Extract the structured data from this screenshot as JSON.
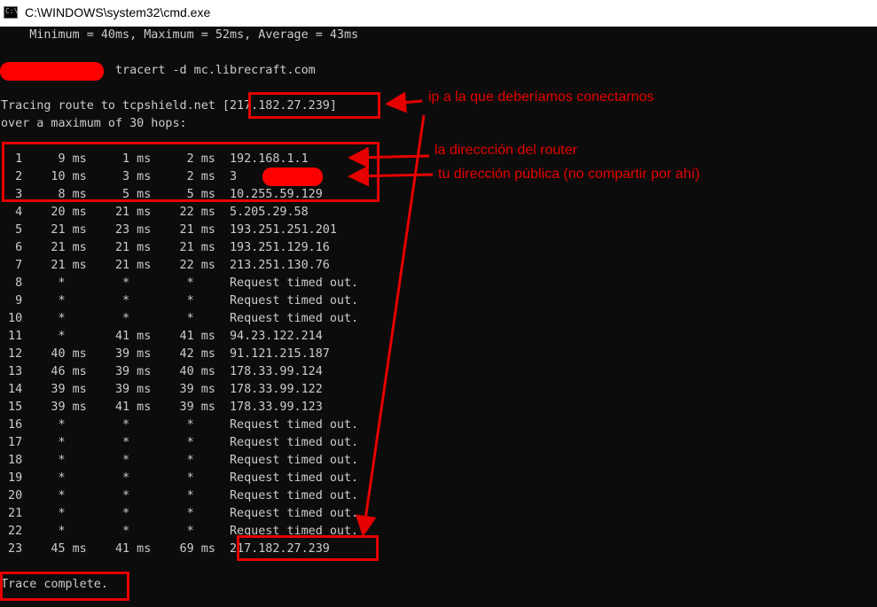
{
  "window": {
    "title": "C:\\WINDOWS\\system32\\cmd.exe",
    "icon": "cmd-console-icon",
    "icon_text": "C:\\"
  },
  "console": {
    "lines": [
      "    Minimum = 40ms, Maximum = 52ms, Average = 43ms",
      "",
      "                tracert -d mc.librecraft.com",
      "",
      "Tracing route to tcpshield.net [217.182.27.239]",
      "over a maximum of 30 hops:",
      "",
      "  1     9 ms     1 ms     2 ms  192.168.1.1",
      "  2    10 ms     3 ms     2 ms  3        .1",
      "  3     8 ms     5 ms     5 ms  10.255.59.129",
      "  4    20 ms    21 ms    22 ms  5.205.29.58",
      "  5    21 ms    23 ms    21 ms  193.251.251.201",
      "  6    21 ms    21 ms    21 ms  193.251.129.16",
      "  7    21 ms    21 ms    22 ms  213.251.130.76",
      "  8     *        *        *     Request timed out.",
      "  9     *        *        *     Request timed out.",
      " 10     *        *        *     Request timed out.",
      " 11     *       41 ms    41 ms  94.23.122.214",
      " 12    40 ms    39 ms    42 ms  91.121.215.187",
      " 13    46 ms    39 ms    40 ms  178.33.99.124",
      " 14    39 ms    39 ms    39 ms  178.33.99.122",
      " 15    39 ms    41 ms    39 ms  178.33.99.123",
      " 16     *        *        *     Request timed out.",
      " 17     *        *        *     Request timed out.",
      " 18     *        *        *     Request timed out.",
      " 19     *        *        *     Request timed out.",
      " 20     *        *        *     Request timed out.",
      " 21     *        *        *     Request timed out.",
      " 22     *        *        *     Request timed out.",
      " 23    45 ms    41 ms    69 ms  217.182.27.239",
      "",
      "Trace complete."
    ]
  },
  "annotations": {
    "target_ip": "ip a la que deberíamos conectarnos",
    "router": "la direccción del router",
    "public_ip": "tu dirección pública (no compartir por ahí)"
  },
  "colors": {
    "console_bg": "#0c0c0c",
    "console_text": "#cccccc",
    "annotation_red": "#e60000",
    "redaction_red": "#ff0000"
  }
}
